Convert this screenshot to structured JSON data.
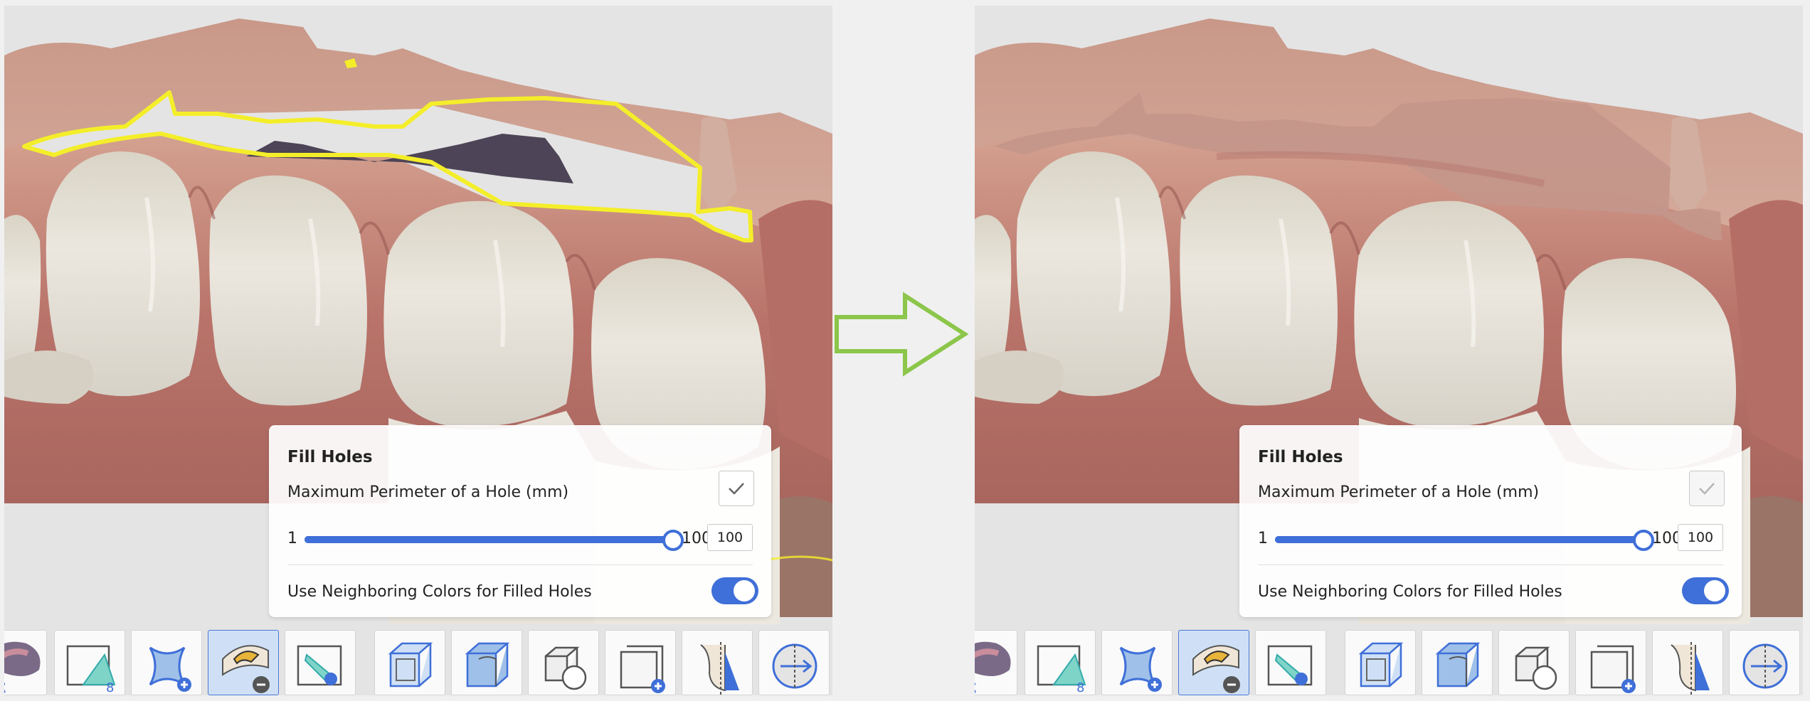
{
  "panels": [
    {
      "title": "Fill Holes",
      "perimeter_label": "Maximum Perimeter of a Hole (mm)",
      "slider_min": "1",
      "slider_max": "100",
      "slider_value": "100",
      "slider_fraction": 1.0,
      "neighbor_label": "Use Neighboring Colors for Filled Holes",
      "toggle_on": true,
      "checkbox_enabled": true
    },
    {
      "title": "Fill Holes",
      "perimeter_label": "Maximum Perimeter of a Hole (mm)",
      "slider_min": "1",
      "slider_max": "100",
      "slider_value": "100",
      "slider_fraction": 1.0,
      "neighbor_label": "Use Neighboring Colors for Filled Holes",
      "toggle_on": true,
      "checkbox_enabled": false
    }
  ],
  "toolbar": {
    "items": [
      {
        "icon": "model-swap-icon",
        "active": false
      },
      {
        "icon": "smart-select-icon",
        "active": false
      },
      {
        "icon": "add-boundary-icon",
        "active": false
      },
      {
        "icon": "fill-holes-icon",
        "active": true
      },
      {
        "icon": "brush-edit-icon",
        "active": false
      },
      {
        "icon": "box-view-icon",
        "active": false
      },
      {
        "icon": "section-view-icon",
        "active": false
      },
      {
        "icon": "shape-tool-icon",
        "active": false
      },
      {
        "icon": "add-layer-icon",
        "active": false
      },
      {
        "icon": "clip-plane-icon",
        "active": false
      },
      {
        "icon": "export-view-icon",
        "active": false
      }
    ]
  },
  "colors": {
    "accent": "#3f6fd8",
    "hole_outline": "#f4ee2a",
    "arrow": "#8cc64a",
    "gum": "#c07c72",
    "tooth": "#e6e2d8"
  }
}
